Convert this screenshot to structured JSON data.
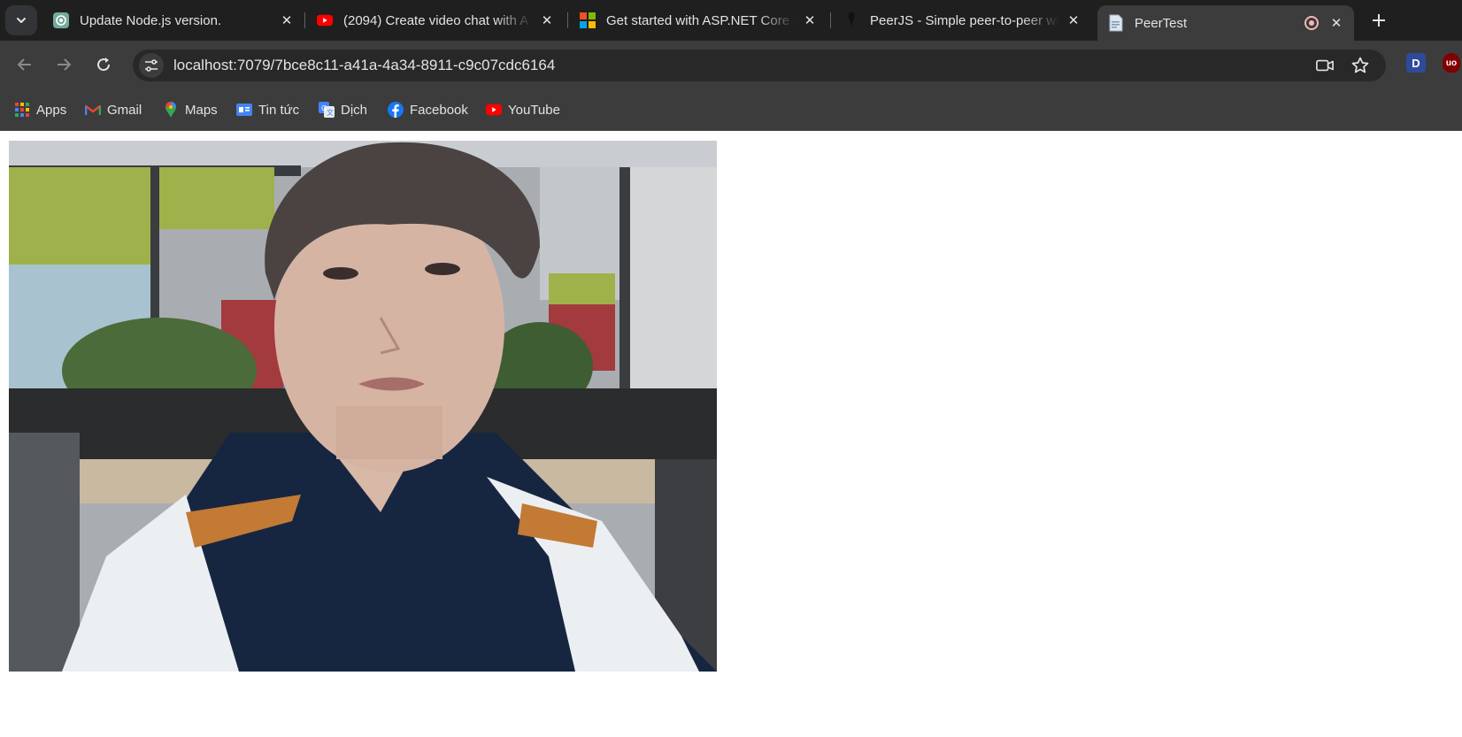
{
  "tabs": [
    {
      "title": "Update Node.js version.",
      "favicon": "chatgpt-icon"
    },
    {
      "title": "(2094) Create video chat with A",
      "favicon": "youtube-icon"
    },
    {
      "title": "Get started with ASP.NET Core S",
      "favicon": "microsoft-icon"
    },
    {
      "title": "PeerJS - Simple peer-to-peer wi",
      "favicon": "peerjs-icon"
    },
    {
      "title": "PeerTest",
      "favicon": "page-icon",
      "active": true,
      "recording": true
    }
  ],
  "toolbar": {
    "url": "localhost:7079/7bce8c11-a41a-4a34-8911-c9c07cdc6164"
  },
  "extensions": {
    "dashlane_label": "D",
    "ublock_label": "uo"
  },
  "bookmarks": [
    {
      "label": "Apps",
      "icon": "apps-grid-icon"
    },
    {
      "label": "Gmail",
      "icon": "gmail-icon"
    },
    {
      "label": "Maps",
      "icon": "maps-icon"
    },
    {
      "label": "Tin tức",
      "icon": "google-news-icon"
    },
    {
      "label": "Dịch",
      "icon": "google-translate-icon"
    },
    {
      "label": "Facebook",
      "icon": "facebook-icon"
    },
    {
      "label": "YouTube",
      "icon": "youtube-icon"
    }
  ],
  "colors": {
    "tabstrip_bg": "#1f1f1f",
    "toolbar_bg": "#3c3c3c",
    "omnibox_bg": "#282828",
    "text": "#e3e3e3",
    "recording_indicator": "#f2b8b5"
  },
  "page": {
    "video": "webcam video stream"
  }
}
